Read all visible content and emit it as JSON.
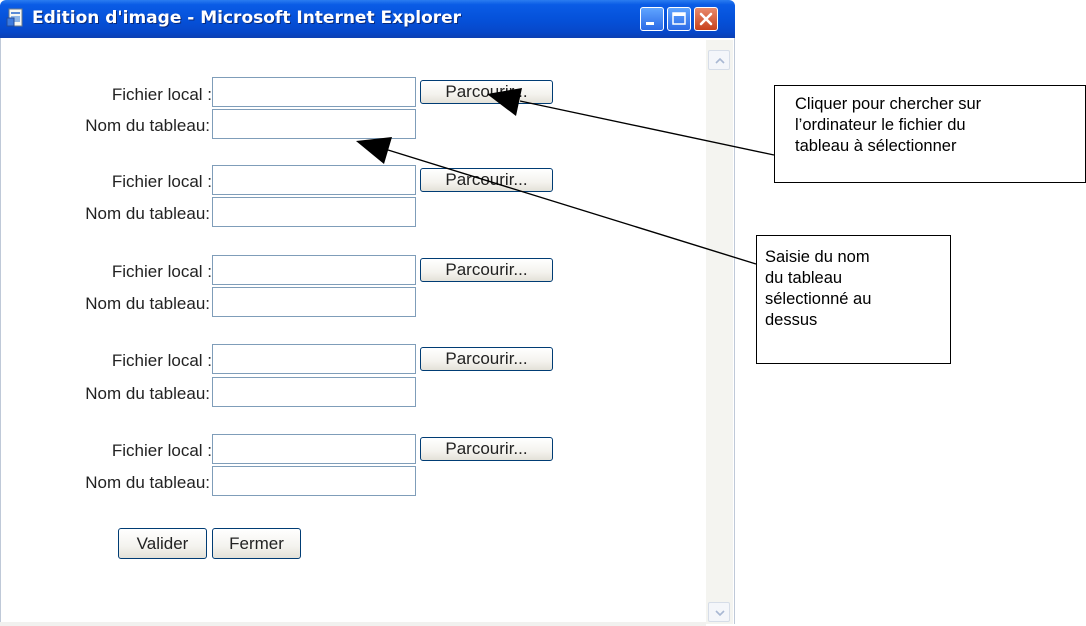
{
  "window": {
    "title": "Edition d'image - Microsoft Internet Explorer"
  },
  "form": {
    "rows": [
      {
        "fichier_label": "Fichier local :",
        "fichier_value": "",
        "browse_label": "Parcourir...",
        "nom_label": "Nom du tableau:",
        "nom_value": ""
      },
      {
        "fichier_label": "Fichier local :",
        "fichier_value": "",
        "browse_label": "Parcourir...",
        "nom_label": "Nom du tableau:",
        "nom_value": ""
      },
      {
        "fichier_label": "Fichier local :",
        "fichier_value": "",
        "browse_label": "Parcourir...",
        "nom_label": "Nom du tableau:",
        "nom_value": ""
      },
      {
        "fichier_label": "Fichier local :",
        "fichier_value": "",
        "browse_label": "Parcourir...",
        "nom_label": "Nom du tableau:",
        "nom_value": ""
      },
      {
        "fichier_label": "Fichier local :",
        "fichier_value": "",
        "browse_label": "Parcourir...",
        "nom_label": "Nom du tableau:",
        "nom_value": ""
      }
    ],
    "valider_label": "Valider",
    "fermer_label": "Fermer"
  },
  "annotations": {
    "browse_callout": "Cliquer pour chercher sur\nl’ordinateur le fichier du\ntableau à sélectionner",
    "name_callout": "Saisie du nom\ndu tableau\nsélectionné au\ndessus"
  },
  "colors": {
    "titlebar": "#0a5ce6",
    "close_button": "#c8411c",
    "input_border": "#7f9db9",
    "button_border": "#003c74"
  },
  "icons": [
    "ie-page-icon",
    "minimize-icon",
    "maximize-icon",
    "close-icon",
    "scroll-up-icon",
    "scroll-down-icon",
    "arrow-pointer-icon"
  ]
}
